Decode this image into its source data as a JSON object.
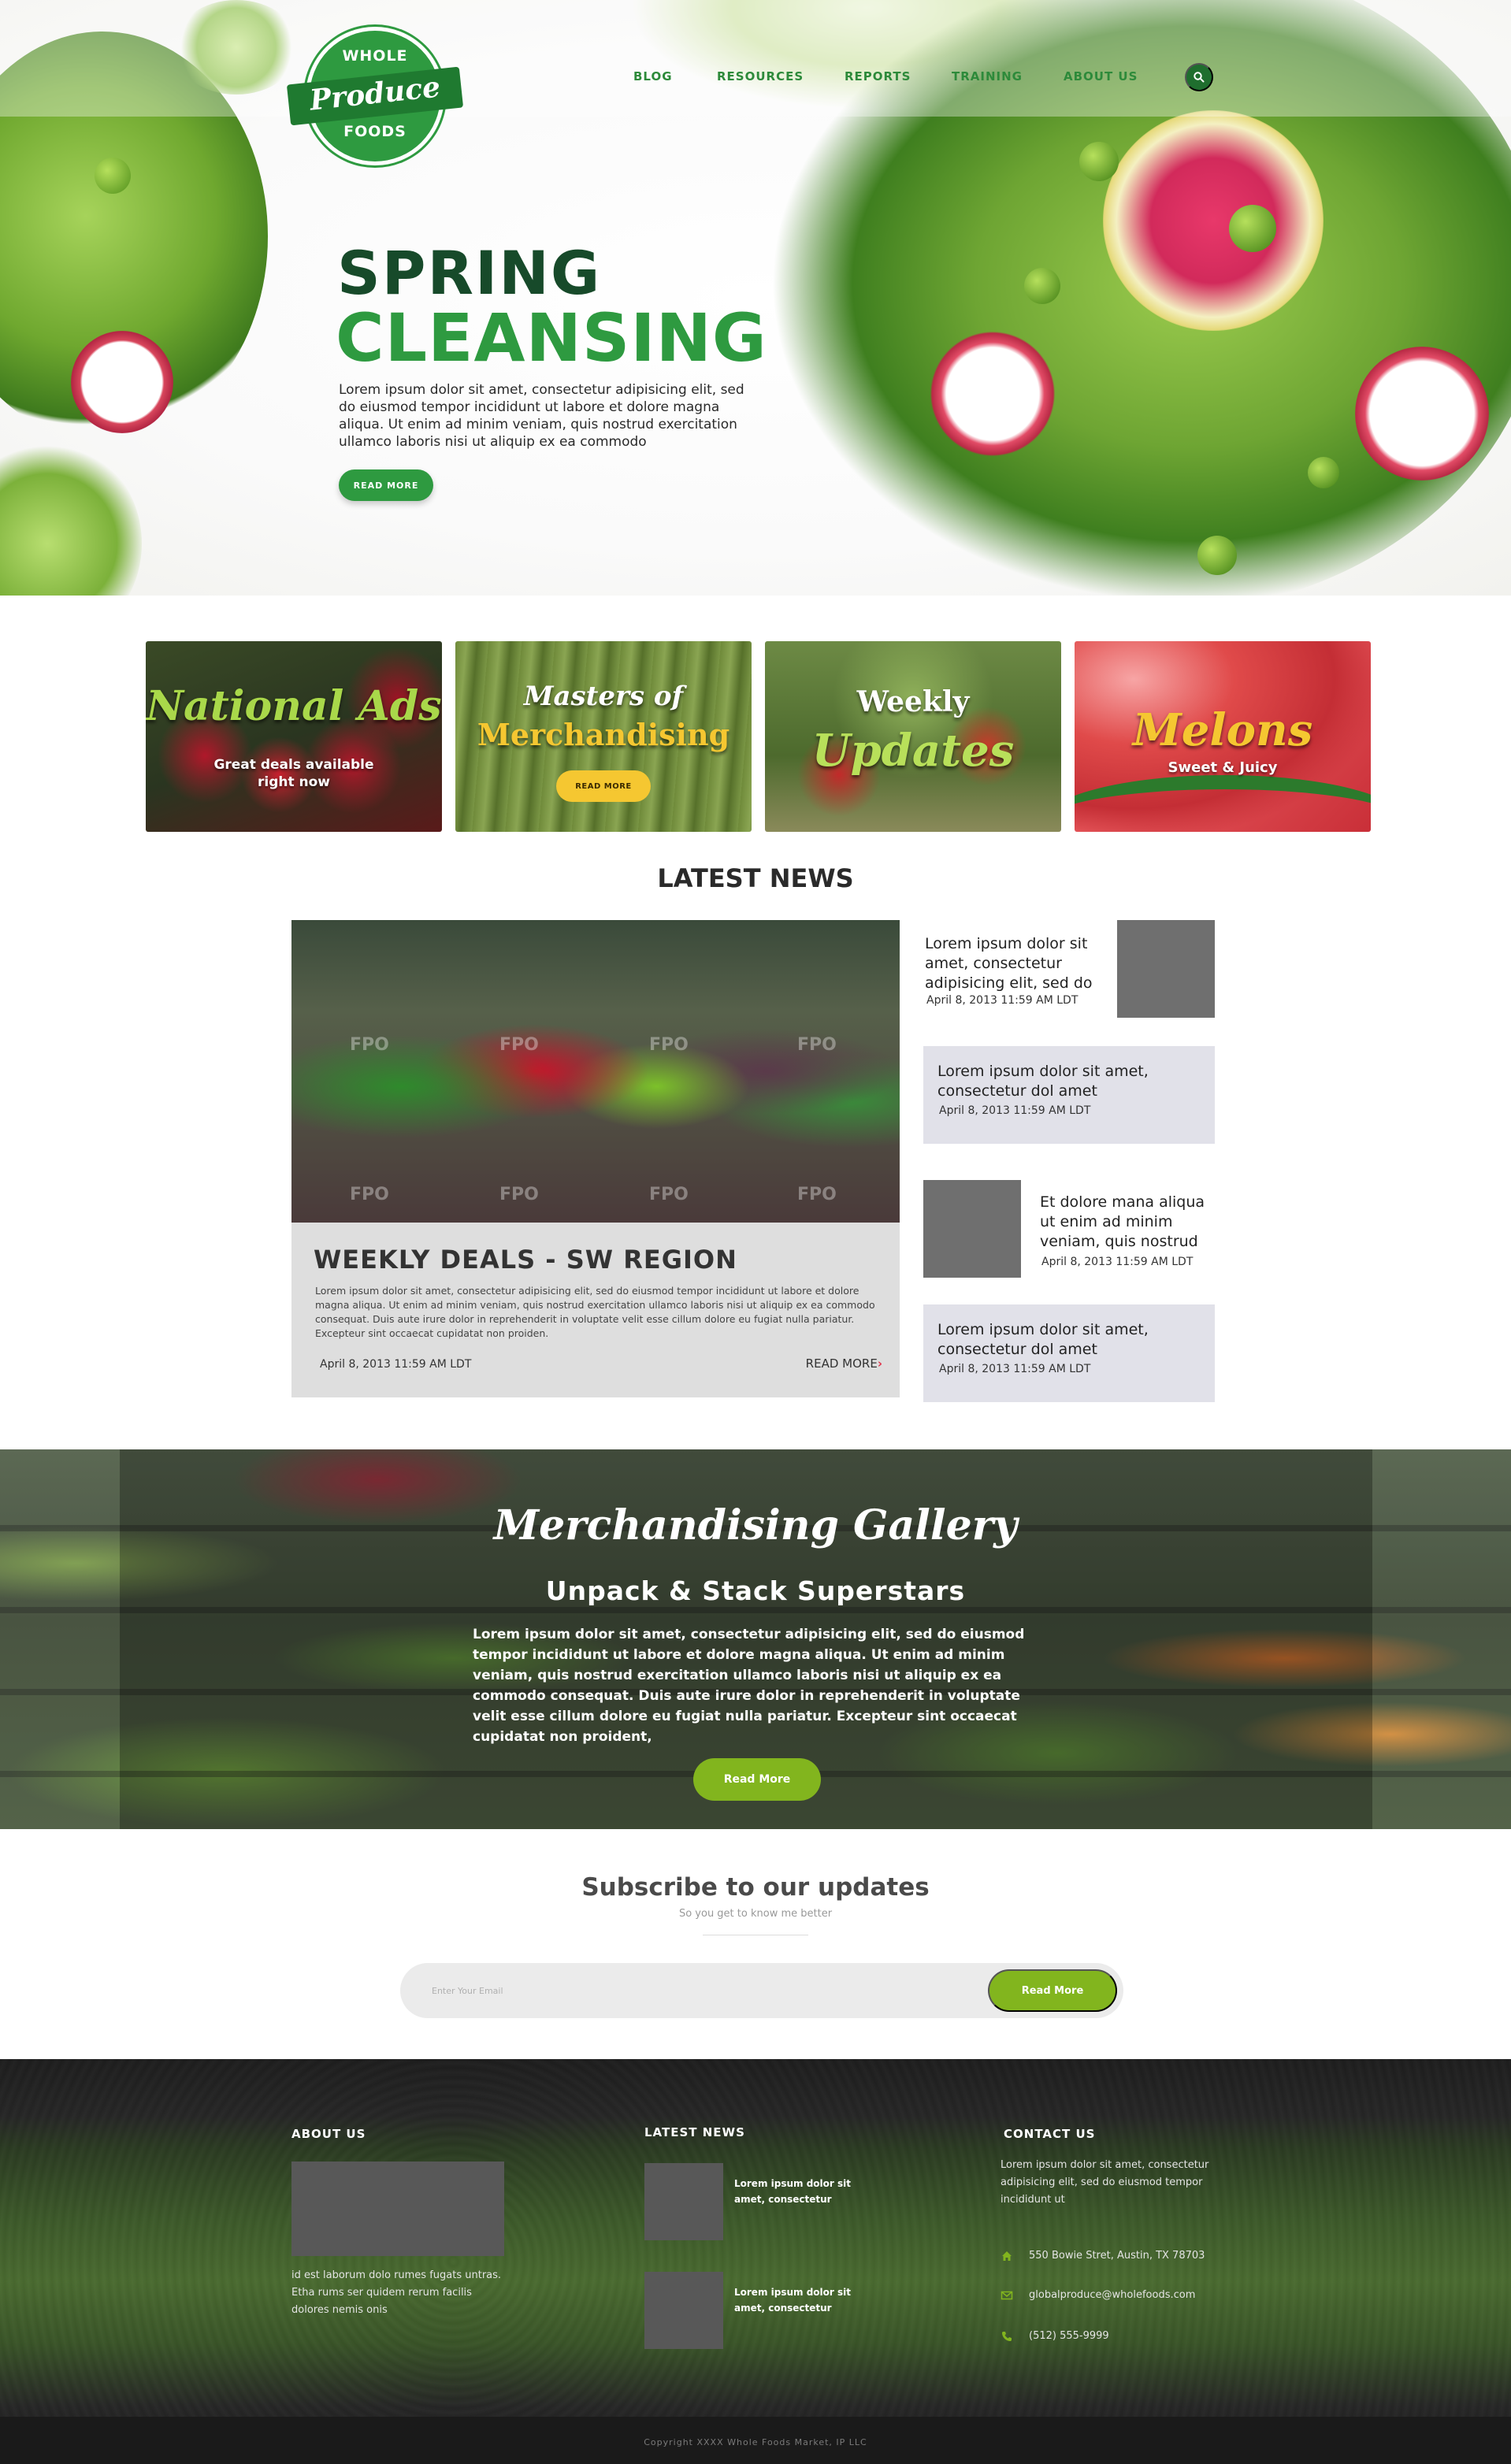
{
  "brand": {
    "logo_top": "WHOLE",
    "logo_script": "Produce",
    "logo_bottom": "FOODS",
    "primary_color": "#2e9a40",
    "dark_green": "#174a2a",
    "accent_lime": "#82b51e",
    "accent_yellow": "#f5c731"
  },
  "nav": {
    "items": [
      {
        "label": "BLOG"
      },
      {
        "label": "RESOURCES"
      },
      {
        "label": "REPORTS"
      },
      {
        "label": "TRAINING"
      },
      {
        "label": "ABOUT US"
      }
    ],
    "search_icon": "search-icon"
  },
  "hero": {
    "title_line_1": "SPRING",
    "title_line_2": "CLEANSING",
    "body": "Lorem ipsum dolor sit amet, consectetur adipisicing elit, sed do eiusmod tempor incididunt ut labore et dolore magna aliqua. Ut enim ad minim veniam, quis nostrud exercitation ullamco laboris nisi ut aliquip ex ea commodo",
    "button": "READ MORE"
  },
  "promos": [
    {
      "title": "National Ads",
      "subtitle": "Great deals available right now"
    },
    {
      "title_small": "Masters of",
      "title": "Merchandising",
      "button": "READ MORE"
    },
    {
      "title_small": "Weekly",
      "title": "Updates"
    },
    {
      "title": "Melons",
      "subtitle": "Sweet & Juicy"
    }
  ],
  "news": {
    "heading": "LATEST NEWS",
    "fpo_label": "FPO",
    "feature": {
      "title": "WEEKLY DEALS - SW REGION",
      "body": "Lorem ipsum dolor sit amet, consectetur adipisicing elit, sed do eiusmod tempor incididunt ut labore et dolore magna aliqua. Ut enim ad minim veniam, quis nostrud exercitation ullamco laboris nisi ut aliquip ex ea commodo consequat. Duis aute irure dolor in reprehenderit in voluptate velit esse cillum dolore eu fugiat nulla pariatur. Excepteur sint occaecat cupidatat non proiden.",
      "date": "April 8, 2013 11:59 AM LDT",
      "read_more": "READ MORE"
    },
    "items": [
      {
        "text": "Lorem ipsum dolor sit amet, consectetur adipisicing elit, sed do",
        "date": "April 8, 2013 11:59 AM LDT"
      },
      {
        "text": "Lorem ipsum dolor sit amet, consectetur dol amet",
        "date": "April 8, 2013 11:59 AM LDT"
      },
      {
        "text": "Et dolore mana aliqua ut enim ad minim veniam, quis nostrud",
        "date": "April 8, 2013 11:59 AM LDT"
      },
      {
        "text": "Lorem ipsum dolor sit amet, consectetur dol amet",
        "date": "April 8, 2013 11:59 AM LDT"
      }
    ]
  },
  "gallery": {
    "script_title": "Merchandising Gallery",
    "subtitle": "Unpack & Stack Superstars",
    "body": "Lorem ipsum dolor sit amet, consectetur adipisicing elit, sed do eiusmod tempor incididunt ut labore et dolore magna aliqua. Ut enim ad minim veniam, quis nostrud exercitation ullamco laboris nisi ut aliquip ex ea commodo consequat. Duis aute irure dolor in reprehenderit in voluptate velit esse cillum dolore eu fugiat nulla pariatur. Excepteur sint occaecat cupidatat non proident,",
    "button": "Read More"
  },
  "subscribe": {
    "title": "Subscribe to our updates",
    "subtitle": "So you get to know me better",
    "placeholder": "Enter Your Email",
    "button": "Read More"
  },
  "footer": {
    "about": {
      "heading": "ABOUT US",
      "text": "id est laborum dolo rumes fugats untras. Etha rums ser quidem rerum facilis dolores nemis onis"
    },
    "latest": {
      "heading": "LATEST NEWS",
      "items": [
        {
          "text": "Lorem ipsum dolor sit amet, consectetur"
        },
        {
          "text": "Lorem ipsum dolor sit amet, consectetur"
        }
      ]
    },
    "contact": {
      "heading": "CONTACT US",
      "text": "Lorem ipsum dolor sit amet, consectetur adipisicing elit, sed do eiusmod tempor incididunt ut",
      "address": "550 Bowie Stret, Austin, TX 78703",
      "email": "globalproduce@wholefoods.com",
      "phone": "(512) 555-9999",
      "icon_color": "#82b51e"
    },
    "copyright": "Copyright XXXX Whole Foods Market, IP LLC"
  }
}
